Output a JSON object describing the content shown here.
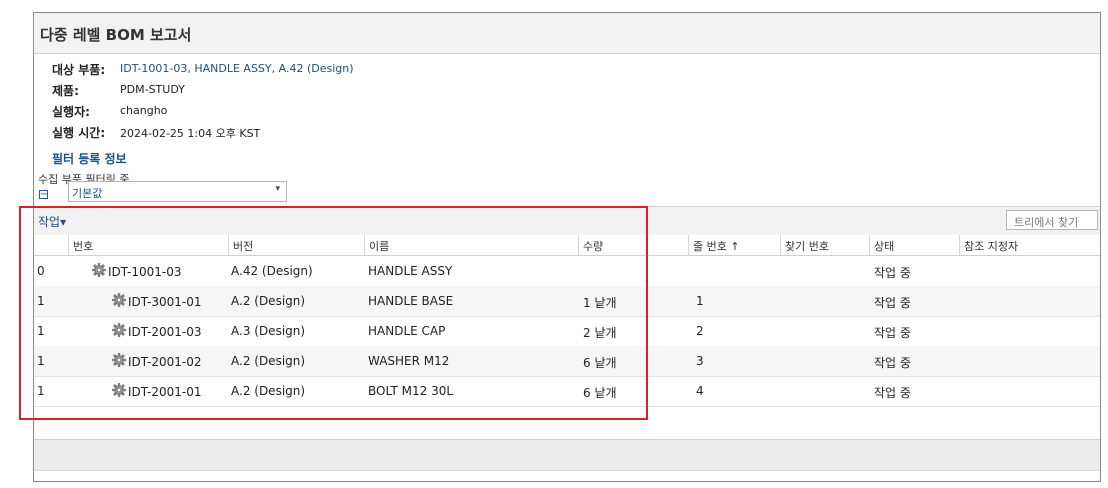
{
  "title": "다중 레벨 BOM 보고서",
  "info": {
    "target_part_label": "대상 부품:",
    "target_part_value": "IDT-1001-03, HANDLE ASSY, A.42 (Design)",
    "product_label": "제품:",
    "product_value": "PDM-STUDY",
    "executor_label": "실행자:",
    "executor_value": "changho",
    "exec_time_label": "실행 시간:",
    "exec_time_value": "2024-02-25 1:04 오후 KST"
  },
  "filter_link": "필터 등록 정보",
  "filter_note": "수집 부품 필터링 중",
  "collapse_symbol": "⊟",
  "view_select": {
    "value": "기본값",
    "arrow": "▾"
  },
  "toolbar": {
    "actions_label": "작업▾",
    "find_placeholder": "트리에서 찾기"
  },
  "columns": {
    "number": "번호",
    "version": "버전",
    "name": "이름",
    "quantity": "수량",
    "line_number": "줄 번호 ↑",
    "find_number": "찾기 번호",
    "state": "상태",
    "ref_designator": "참조 지정자"
  },
  "rows": [
    {
      "level": "0",
      "number": "IDT-1001-03",
      "version": "A.42 (Design)",
      "name": "HANDLE ASSY",
      "quantity": "",
      "line": "",
      "find": "",
      "state": "작업 중",
      "ref": ""
    },
    {
      "level": "1",
      "number": "IDT-3001-01",
      "version": "A.2 (Design)",
      "name": "HANDLE BASE",
      "quantity": "1 낱개",
      "line": "1",
      "find": "",
      "state": "작업 중",
      "ref": ""
    },
    {
      "level": "1",
      "number": "IDT-2001-03",
      "version": "A.3 (Design)",
      "name": "HANDLE CAP",
      "quantity": "2 낱개",
      "line": "2",
      "find": "",
      "state": "작업 중",
      "ref": ""
    },
    {
      "level": "1",
      "number": "IDT-2001-02",
      "version": "A.2 (Design)",
      "name": "WASHER M12",
      "quantity": "6 낱개",
      "line": "3",
      "find": "",
      "state": "작업 중",
      "ref": ""
    },
    {
      "level": "1",
      "number": "IDT-2001-01",
      "version": "A.2 (Design)",
      "name": "BOLT M12 30L",
      "quantity": "6 낱개",
      "line": "4",
      "find": "",
      "state": "작업 중",
      "ref": ""
    }
  ],
  "colors": {
    "link": "#1a4f8a",
    "highlight_box": "#d62424",
    "header_bg": "#f2f2f2"
  }
}
